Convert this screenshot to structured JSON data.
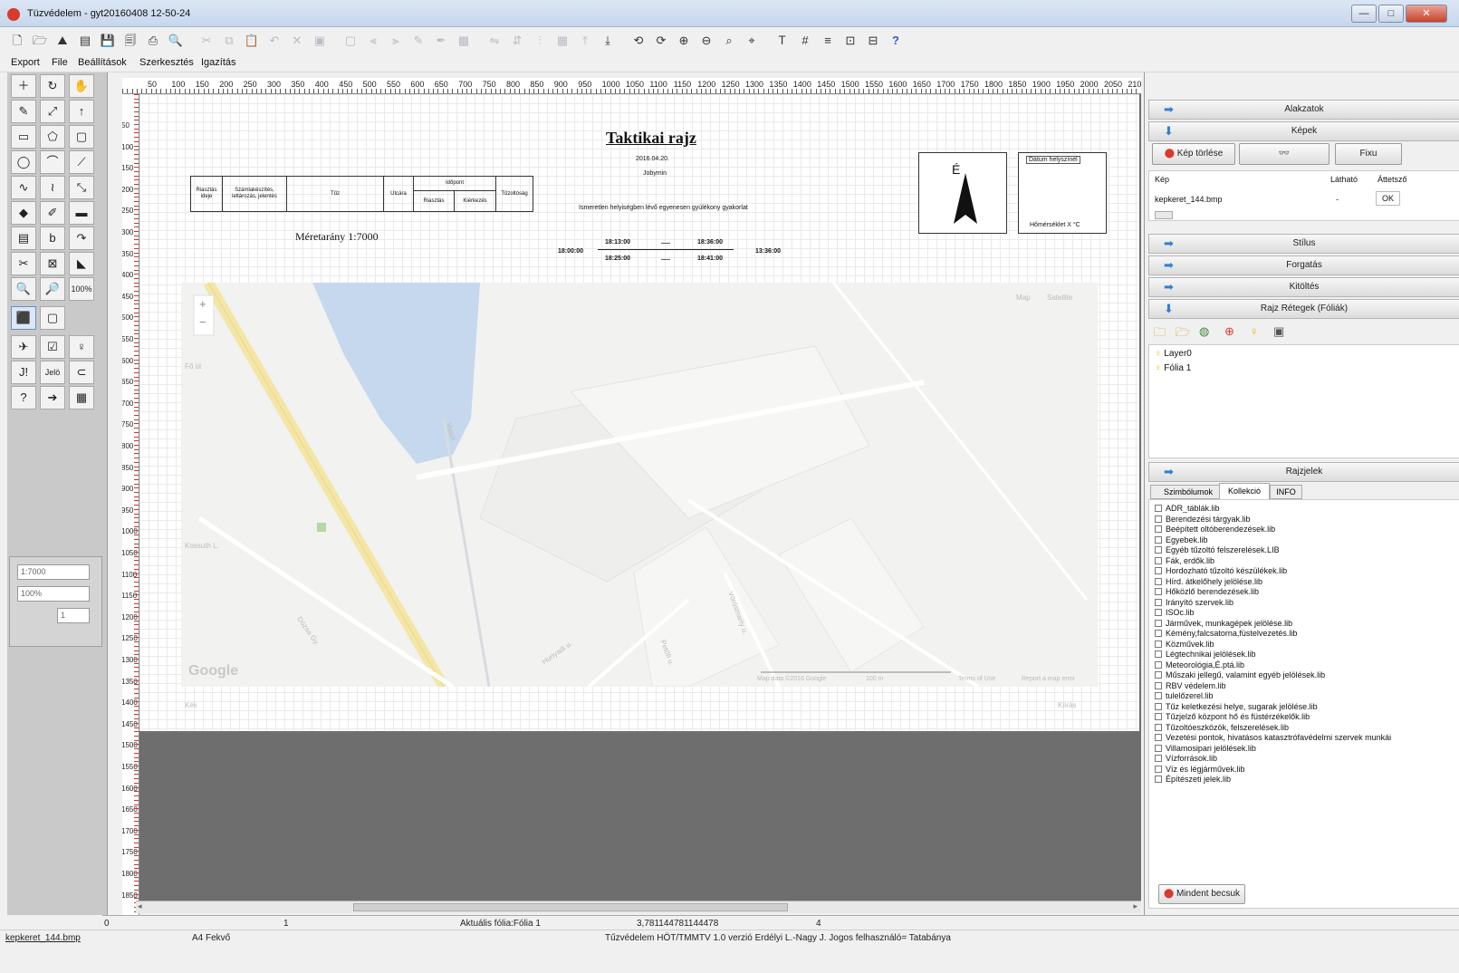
{
  "window": {
    "title": "Tüzvédelem - gyt20160408 12-50-24",
    "min_label": "—",
    "max_label": "□",
    "close_label": "✕"
  },
  "menu": [
    "Export",
    "File",
    "Beállítások",
    "Szerkesztés",
    "Igazítás"
  ],
  "toolbar_icons": [
    "new-icon",
    "open-icon",
    "gallery-icon",
    "image-icon",
    "save-icon",
    "save-as-icon",
    "print-icon",
    "print-preview-icon",
    "cut-icon",
    "copy-icon",
    "paste-icon",
    "undo-icon",
    "delete-icon",
    "group-icon",
    "ungroup-icon",
    "align-left-icon",
    "align-right-icon",
    "pencil-icon",
    "pen-icon",
    "fill-icon",
    "flip-h-icon",
    "flip-v-icon",
    "distribute-icon",
    "grid-icon",
    "bring-front-icon",
    "send-back-icon",
    "rotate-left-icon",
    "rotate-right-icon",
    "zoom-in-icon",
    "zoom-out-icon",
    "zoom-select-icon",
    "zoom-page-icon",
    "text-icon",
    "table-icon",
    "layers-icon",
    "lock-icon",
    "unlock-icon",
    "help-icon"
  ],
  "ruler": {
    "h": [
      "50",
      "100",
      "150",
      "200",
      "250",
      "300",
      "350",
      "400",
      "450",
      "500",
      "550",
      "600",
      "650",
      "700",
      "750",
      "800",
      "850",
      "900",
      "950",
      "1000",
      "1050",
      "1100",
      "1150",
      "1200",
      "1250",
      "1300",
      "1350",
      "1400",
      "1450",
      "1500",
      "1550",
      "1600",
      "1650",
      "1700",
      "1750",
      "1800",
      "1850",
      "1900",
      "1950",
      "2000",
      "2050",
      "2100"
    ],
    "v": [
      "50",
      "100",
      "150",
      "200",
      "250",
      "300",
      "350",
      "400",
      "450",
      "500",
      "550",
      "600",
      "650",
      "700",
      "750",
      "800",
      "850",
      "900",
      "950",
      "1000",
      "1050",
      "1100",
      "1150",
      "1200",
      "1250",
      "1300",
      "1350",
      "1400",
      "1450",
      "1500",
      "1550",
      "1600",
      "1650",
      "1700",
      "1750",
      "1800",
      "1850"
    ]
  },
  "paper": {
    "title": "Taktikai rajz",
    "date": "2016.04.20.",
    "place": "Jobymin",
    "scale_text": "Méretarány 1:7000",
    "subject": "Ismeretlen helyiségben lévő egyenesen gyúlékony gyakorlat",
    "table_headers": [
      "Riasztás ideje",
      "Számlakészítés, leltározás, jelentés",
      "Tűz",
      "Utcára",
      "Időpont",
      "Riasztás",
      "Kiérkezés",
      "Tűzoltóság"
    ],
    "times": {
      "t_left": "18:00:00",
      "t1": "18:13:00",
      "t2": "18:25:00",
      "t3": "18:36:00",
      "t4": "18:41:00",
      "t_right": "13:36:00"
    },
    "north_label": "É",
    "weather_top": "Dátum helyszínél",
    "weather_bottom": "Hőmérséklet X °C"
  },
  "map": {
    "top_links": [
      "Map",
      "Satellite"
    ],
    "labels": [
      "Fő út",
      "Kossuth L.",
      "Vasút",
      "Hunyadi u.",
      "Petőfi u.",
      "Vörösmarty u.",
      "Dózsa Gy."
    ],
    "google": "Google",
    "footer": [
      "Map data ©2016 Google",
      "100 m",
      "Terms of Use",
      "Report a map error"
    ],
    "caption_left": "Kék",
    "caption_right": "Kiírás"
  },
  "left_panel": {
    "scale_value": "1:7000",
    "zoom_value": "100%",
    "line_value": "1"
  },
  "tools": [
    "＋",
    "↻",
    "✋",
    "✎",
    "⤢",
    "↑",
    "▭",
    "⬠",
    "▢",
    "◯",
    "⌒",
    "⟋",
    "∿",
    "≀",
    "⤡",
    "◆",
    "✐",
    "▬",
    "▤",
    "b",
    "↷",
    "✂",
    "⊠",
    "◣",
    "🔍",
    "🔎",
    "100%",
    "⬛",
    "▢",
    "✈",
    "☑",
    "♀",
    "J!",
    "Jelö",
    "⊂",
    "?",
    "➔",
    "▦"
  ],
  "right_panel": {
    "sections": {
      "alakzatok": "Alakzatok",
      "kepek": "Képek",
      "stilus": "Stílus",
      "forgatas": "Forgatás",
      "kitoltes": "Kitöltés",
      "rajz_retegek": "Rajz Rétegek (Fóliák)",
      "rajzjelek": "Rajzjelek"
    },
    "image_buttons": {
      "load": "Kép törlése",
      "icon": "",
      "fill": "Fixu"
    },
    "image_table": {
      "headers": [
        "Kép",
        "Látható",
        "Áttetsző"
      ],
      "row": {
        "name": "kepkeret_144.bmp",
        "visible": "-",
        "transparent": "OK"
      }
    },
    "layers": [
      "Layer0",
      "Fólia 1"
    ],
    "tabs": [
      "Szimbólumok",
      "Kollekció",
      "INFO"
    ],
    "active_tab": "Kollekció",
    "libraries": [
      "ADR_táblák.lib",
      "Berendezési tárgyak.lib",
      "Beépített oltóberendezések.lib",
      "Egyebek.lib",
      "Egyéb tűzoltó felszerelések.LIB",
      "Fák, erdők.lib",
      "Hordozható tűzoltó készülékek.lib",
      "Hírd. átkelőhely jelölése.lib",
      "Hőközlő berendezések.lib",
      "Irányító szervek.lib",
      "ISOc.lib",
      "Járművek, munkagépek jelölése.lib",
      "Kémény,falcsatorna,füstelvezetés.lib",
      "Közművek.lib",
      "Légtechnikai jelölések.lib",
      "Meteorológia,É.ptá.lib",
      "Műszaki jellegű, valamint egyéb jelölések.lib",
      "RBV védelem.lib",
      "tulelőzerel.lib",
      "Tűz keletkezési helye, sugarak jelölése.lib",
      "Tűzjelző központ hő és füstérzékelők.lib",
      "Tűzoltóeszközök, felszerelések.lib",
      "Vezetési pontok, hivatásos katasztrófavédelmi szervek munkái",
      "Villamosipari jelölések.lib",
      "Vízforrások.lib",
      "Víz és légjárművek.lib",
      "Építészeti jelek.lib"
    ],
    "clear_all": "Mindent becsuk"
  },
  "status": {
    "row1": [
      "0",
      "1",
      "Aktuális fólia:Fólia 1",
      "3,781144781144478",
      "4"
    ],
    "row2": [
      "kepkeret_144.bmp",
      "A4 Fekvő",
      "Tűzvédelem HÖT/TMMTV 1.0 verzió Erdélyi L.-Nagy J.  Jogos felhasználó= Tatabánya"
    ]
  },
  "colors": {
    "accent": "#2f7fd6",
    "canvas_bg": "#6e6e6e",
    "road": "#f3e6a6",
    "water": "#c6d8ee"
  }
}
